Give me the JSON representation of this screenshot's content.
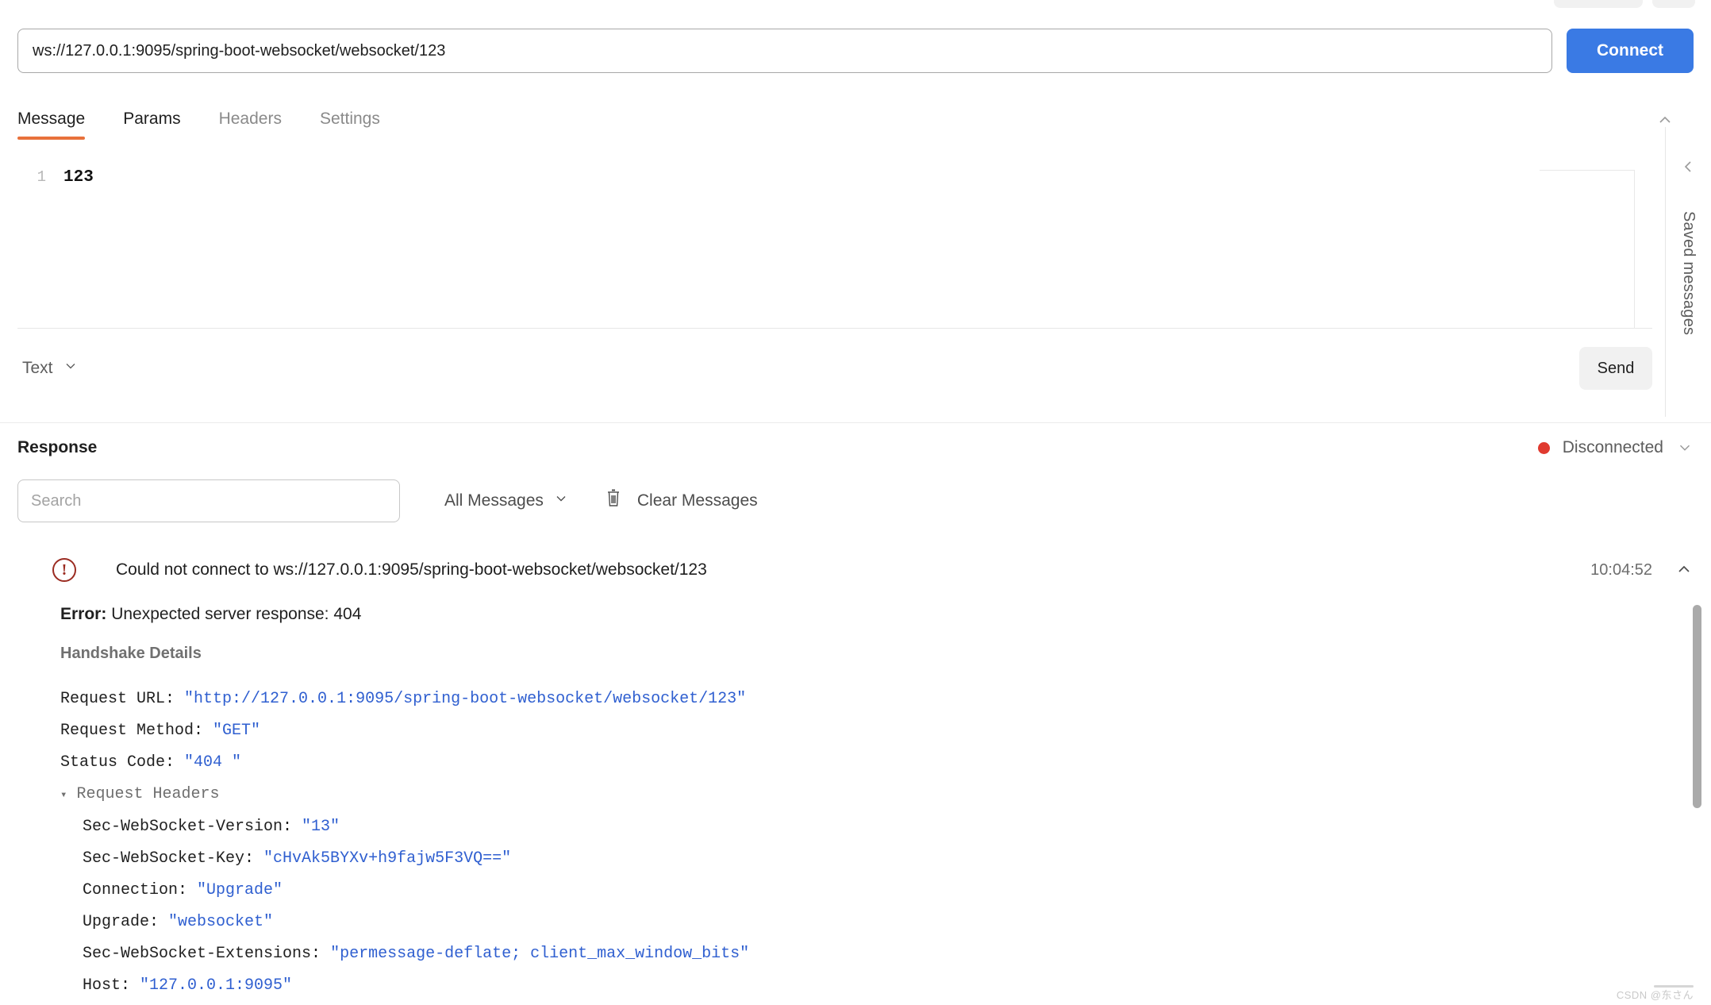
{
  "connection": {
    "url_value": "ws://127.0.0.1:9095/spring-boot-websocket/websocket/123",
    "url_placeholder": "Enter WebSocket URL",
    "connect_label": "Connect"
  },
  "tabs": [
    {
      "label": "Message",
      "active": true
    },
    {
      "label": "Params",
      "active": false
    },
    {
      "label": "Headers",
      "active": false
    },
    {
      "label": "Settings",
      "active": false
    }
  ],
  "editor": {
    "line_number": "1",
    "content": "123"
  },
  "send_bar": {
    "type_label": "Text",
    "send_label": "Send"
  },
  "right_rail": {
    "saved_messages_label": "Saved messages"
  },
  "response": {
    "title": "Response",
    "status_label": "Disconnected",
    "status_color": "#e03a2f",
    "search_placeholder": "Search",
    "search_value": "",
    "filter_label": "All Messages",
    "clear_label": "Clear Messages",
    "entry": {
      "summary": "Could not connect to ws://127.0.0.1:9095/spring-boot-websocket/websocket/123",
      "timestamp": "10:04:52",
      "error_label": "Error:",
      "error_text": "Unexpected server response: 404",
      "handshake_title": "Handshake Details",
      "details": [
        {
          "key": "Request URL: ",
          "value": "\"http://127.0.0.1:9095/spring-boot-websocket/websocket/123\"",
          "indent": 0
        },
        {
          "key": "Request Method: ",
          "value": "\"GET\"",
          "indent": 0
        },
        {
          "key": "Status Code: ",
          "value": "\"404 \"",
          "indent": 0
        }
      ],
      "request_headers_label": "Request Headers",
      "request_headers": [
        {
          "key": "Sec-WebSocket-Version: ",
          "value": "\"13\""
        },
        {
          "key": "Sec-WebSocket-Key: ",
          "value": "\"cHvAk5BYXv+h9fajw5F3VQ==\""
        },
        {
          "key": "Connection: ",
          "value": "\"Upgrade\""
        },
        {
          "key": "Upgrade: ",
          "value": "\"websocket\""
        },
        {
          "key": "Sec-WebSocket-Extensions: ",
          "value": "\"permessage-deflate; client_max_window_bits\""
        },
        {
          "key": "Host: ",
          "value": "\"127.0.0.1:9095\""
        }
      ]
    }
  },
  "watermark": "CSDN @东さん"
}
